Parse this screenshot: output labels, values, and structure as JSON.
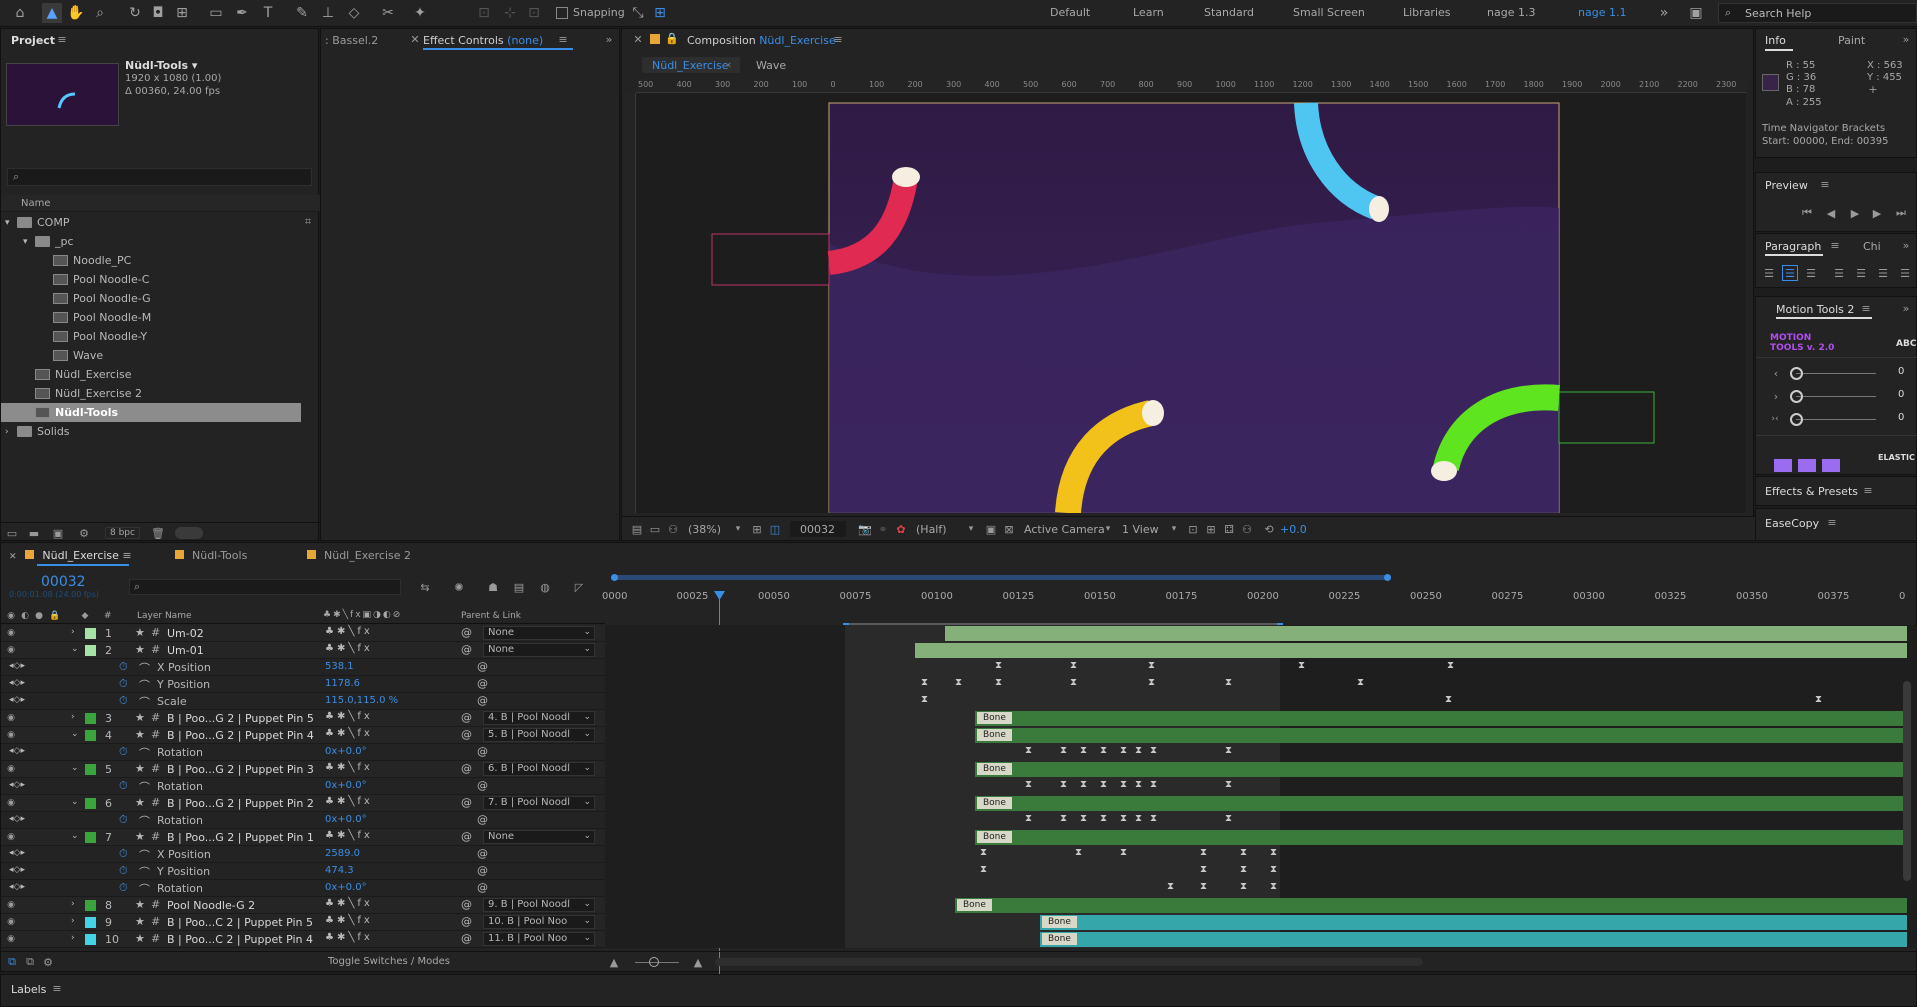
{
  "toolbar": {
    "snapping_label": "Snapping",
    "workspaces": [
      "Default",
      "Learn",
      "Standard",
      "Small Screen",
      "Libraries",
      "nage 1.3",
      "nage 1.1"
    ],
    "active_workspace": "nage 1.1",
    "search_placeholder": "Search Help"
  },
  "project": {
    "panel_title": "Project",
    "comp_name": "Nüdl-Tools ▾",
    "comp_size": "1920 x 1080 (1.00)",
    "comp_duration": "Δ 00360, 24.00 fps",
    "search_placeholder": "",
    "column_name": "Name",
    "tree": [
      {
        "label": "COMP",
        "type": "folder",
        "indent": 0,
        "expanded": true
      },
      {
        "label": "_pc",
        "type": "folder",
        "indent": 1,
        "expanded": true
      },
      {
        "label": "Noodle_PC",
        "type": "comp",
        "indent": 2
      },
      {
        "label": "Pool Noodle-C",
        "type": "comp",
        "indent": 2
      },
      {
        "label": "Pool Noodle-G",
        "type": "comp",
        "indent": 2
      },
      {
        "label": "Pool Noodle-M",
        "type": "comp",
        "indent": 2
      },
      {
        "label": "Pool Noodle-Y",
        "type": "comp",
        "indent": 2
      },
      {
        "label": "Wave",
        "type": "comp",
        "indent": 2
      },
      {
        "label": "Nüdl_Exercise",
        "type": "comp",
        "indent": 1
      },
      {
        "label": "Nüdl_Exercise 2",
        "type": "comp",
        "indent": 1
      },
      {
        "label": "Nüdl-Tools",
        "type": "comp",
        "indent": 1,
        "selected": true
      },
      {
        "label": "Solids",
        "type": "folder",
        "indent": 0,
        "expanded": false
      }
    ],
    "bpc": "8 bpc"
  },
  "effects": {
    "tab_prev": ": Bassel.2",
    "tab_label": "Effect Controls",
    "tab_none": "(none)"
  },
  "composition": {
    "tab_prefix": "Composition",
    "tab_name": "Nüdl_Exercise",
    "sub_tab_active": "Nüdl_Exercise",
    "sub_tab_other": "Wave",
    "ruler_labels": [
      "500",
      "400",
      "300",
      "200",
      "100",
      "0",
      "100",
      "200",
      "300",
      "400",
      "500",
      "600",
      "700",
      "800",
      "900",
      "1000",
      "1100",
      "1200",
      "1300",
      "1400",
      "1500",
      "1600",
      "1700",
      "1800",
      "1900",
      "2000",
      "2100",
      "2200",
      "2300"
    ],
    "zoom": "(38%)",
    "timecode": "00032",
    "resolution": "(Half)",
    "camera": "Active Camera",
    "views": "1 View",
    "exposure": "+0.0"
  },
  "info": {
    "tab_info": "Info",
    "tab_paint": "Paint",
    "r": "R : 55",
    "g": "G : 36",
    "b": "B : 78",
    "a": "A : 255",
    "x": "X : 563",
    "y": "Y : 455",
    "note1": "Time Navigator Brackets",
    "note2": "Start: 00000, End: 00395",
    "swatch_color": "#372448"
  },
  "preview": {
    "title": "Preview"
  },
  "paragraph": {
    "title": "Paragraph",
    "tab2": "Chi"
  },
  "motion_tools": {
    "title": "Motion Tools 2",
    "logo_line1": "MOTION",
    "logo_line2": "TOOLS v. 2.0",
    "abc": "ABC",
    "slider_values": [
      "0",
      "0",
      "0"
    ],
    "elastic": "ELASTIC"
  },
  "effects_presets": {
    "title": "Effects & Presets"
  },
  "easecopy": {
    "title": "EaseCopy"
  },
  "timeline": {
    "tabs": [
      {
        "label": "Nüdl_Exercise",
        "active": true
      },
      {
        "label": "Nüdl-Tools",
        "active": false
      },
      {
        "label": "Nüdl_Exercise 2",
        "active": false
      }
    ],
    "timecode": "00032",
    "timecode_sub": "0:00:01:08 (24.00 fps)",
    "col_layer_name": "Layer Name",
    "col_parent": "Parent & Link",
    "ruler": [
      "0000",
      "00025",
      "00050",
      "00075",
      "00100",
      "00125",
      "00150",
      "00175",
      "00200",
      "00225",
      "00250",
      "00275",
      "00300",
      "00325",
      "00350",
      "00375",
      "0"
    ],
    "layers": [
      {
        "num": "1",
        "name": "Um-02",
        "color": "#a4e3a4",
        "parent": "None",
        "kind": "layer"
      },
      {
        "num": "2",
        "name": "Um-01",
        "color": "#a4e3a4",
        "parent": "None",
        "kind": "layer",
        "open": true
      },
      {
        "num": "",
        "name": "X Position",
        "value": "538.1",
        "kind": "prop"
      },
      {
        "num": "",
        "name": "Y Position",
        "value": "1178.6",
        "kind": "prop"
      },
      {
        "num": "",
        "name": "Scale",
        "value": "115.0,115.0 %",
        "kind": "prop"
      },
      {
        "num": "3",
        "name": "B | Poo...G 2 | Puppet Pin 5",
        "color": "#3aa53a",
        "parent": "4. B | Pool Noodl",
        "kind": "layer"
      },
      {
        "num": "4",
        "name": "B | Poo...G 2 | Puppet Pin 4",
        "color": "#3aa53a",
        "parent": "5. B | Pool Noodl",
        "kind": "layer",
        "open": true
      },
      {
        "num": "",
        "name": "Rotation",
        "value": "0x+0.0°",
        "kind": "prop"
      },
      {
        "num": "5",
        "name": "B | Poo...G 2 | Puppet Pin 3",
        "color": "#3aa53a",
        "parent": "6. B | Pool Noodl",
        "kind": "layer",
        "open": true
      },
      {
        "num": "",
        "name": "Rotation",
        "value": "0x+0.0°",
        "kind": "prop"
      },
      {
        "num": "6",
        "name": "B | Poo...G 2 | Puppet Pin 2",
        "color": "#3aa53a",
        "parent": "7. B | Pool Noodl",
        "kind": "layer",
        "open": true
      },
      {
        "num": "",
        "name": "Rotation",
        "value": "0x+0.0°",
        "kind": "prop"
      },
      {
        "num": "7",
        "name": "B | Poo...G 2 | Puppet Pin 1",
        "color": "#3aa53a",
        "parent": "None",
        "kind": "layer",
        "open": true
      },
      {
        "num": "",
        "name": "X Position",
        "value": "2589.0",
        "kind": "prop"
      },
      {
        "num": "",
        "name": "Y Position",
        "value": "474.3",
        "kind": "prop"
      },
      {
        "num": "",
        "name": "Rotation",
        "value": "0x+0.0°",
        "kind": "prop"
      },
      {
        "num": "8",
        "name": "Pool Noodle-G 2",
        "color": "#3aa53a",
        "parent": "9. B | Pool Noodl",
        "kind": "layer"
      },
      {
        "num": "9",
        "name": "B | Poo...C 2 | Puppet Pin 5",
        "color": "#44d4e8",
        "parent": "10. B | Pool Noo",
        "kind": "layer"
      },
      {
        "num": "10",
        "name": "B | Poo...C 2 | Puppet Pin 4",
        "color": "#44d4e8",
        "parent": "11. B | Pool Noo",
        "kind": "layer"
      }
    ],
    "bone_label": "Bone",
    "toggle_label": "Toggle Switches / Modes"
  },
  "labels_panel": {
    "title": "Labels"
  }
}
